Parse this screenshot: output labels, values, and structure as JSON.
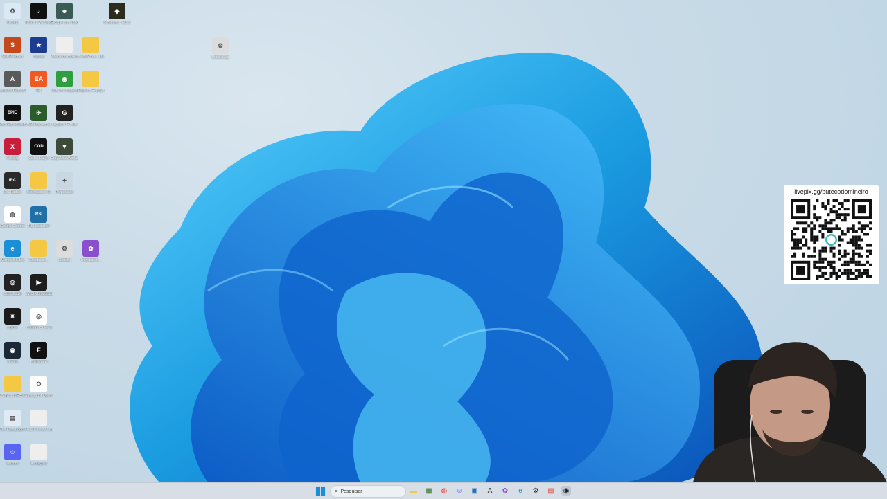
{
  "desktop": {
    "icons": [
      {
        "label": "Lixeira",
        "icon": "recycle-bin-icon",
        "color": "#dbe8f5",
        "glyph": "♻"
      },
      {
        "label": "TikTok LIVE Studio",
        "icon": "tiktok-icon",
        "color": "#111111",
        "glyph": "♪"
      },
      {
        "label": "Escape from Tarkov",
        "icon": "tarkov-icon",
        "color": "#3a5a55",
        "glyph": "☻"
      },
      {
        "label": "ScreenMi... Ajuda",
        "icon": "app-icon",
        "color": "#2b2b1e",
        "glyph": "◆"
      },
      {
        "label": "SCUM Admin",
        "icon": "scum-icon",
        "color": "#c4481a",
        "glyph": "S"
      },
      {
        "label": "Stanza",
        "icon": "app-icon",
        "color": "#1d3b8f",
        "glyph": "★"
      },
      {
        "label": "Vídeos do coisecti...",
        "icon": "document-icon",
        "color": "#eeeeee",
        "glyph": ""
      },
      {
        "label": "mediaProfil... (1)",
        "icon": "folder-icon",
        "color": "#f4c842",
        "glyph": ""
      },
      {
        "label": "Battlenet Games L...",
        "icon": "app-icon",
        "color": "#5a5a5a",
        "glyph": "A"
      },
      {
        "label": "EA",
        "icon": "ea-icon",
        "color": "#f05a22",
        "glyph": "EA"
      },
      {
        "label": "Teste de Integrac...",
        "icon": "app-icon",
        "color": "#2e9e3e",
        "glyph": "◉"
      },
      {
        "label": "Arquivos Replays",
        "icon": "folder-icon",
        "color": "#f4c842",
        "glyph": ""
      },
      {
        "label": "Epic Games Launcher",
        "icon": "epic-games-icon",
        "color": "#111111",
        "glyph": "EPIC"
      },
      {
        "label": "MSI Afterburner",
        "icon": "msi-afterburner-icon",
        "color": "#2a5d2a",
        "glyph": "✈"
      },
      {
        "label": "Logitech G HUB",
        "icon": "logitech-icon",
        "color": "#222222",
        "glyph": "G"
      },
      {
        "label": "FxSoug",
        "icon": "app-icon",
        "color": "#c81e3c",
        "glyph": "X"
      },
      {
        "label": "Call of Duty®",
        "icon": "call-of-duty-icon",
        "color": "#111111",
        "glyph": "COD"
      },
      {
        "label": "Gray Zone Warfare",
        "icon": "gray-zone-icon",
        "color": "#3d4a3a",
        "glyph": "▼"
      },
      {
        "label": "IRC Radars",
        "icon": "app-icon",
        "color": "#2a2a2a",
        "glyph": "IRC"
      },
      {
        "label": "Informações (1)",
        "icon": "folder-icon",
        "color": "#f4c842",
        "glyph": ""
      },
      {
        "label": "Preparacão",
        "icon": "app-icon",
        "color": "#c9d7e2",
        "glyph": "✦"
      },
      {
        "label": "Google Chrome",
        "icon": "chrome-icon",
        "color": "#ffffff",
        "glyph": "◍"
      },
      {
        "label": "RSI Launcher",
        "icon": "rsi-icon",
        "color": "#1f6fa8",
        "glyph": "RSI"
      },
      {
        "label": "Microsoft Edge",
        "icon": "edge-icon",
        "color": "#1a8fd6",
        "glyph": "e"
      },
      {
        "label": "Claudio.cs...",
        "icon": "folder-icon",
        "color": "#f4c842",
        "glyph": ""
      },
      {
        "label": "Cloudflu",
        "icon": "app-icon",
        "color": "#dcdcdc",
        "glyph": "⚙"
      },
      {
        "label": "Transparen...",
        "icon": "app-icon",
        "color": "#8a4fcf",
        "glyph": "✿"
      },
      {
        "label": "OBS Studio",
        "icon": "obs-icon",
        "color": "#222222",
        "glyph": "◎"
      },
      {
        "label": "NVIDIA Broadcast",
        "icon": "nvidia-icon",
        "color": "#1e1e1e",
        "glyph": "▶"
      },
      {
        "label": "Spider",
        "icon": "app-icon",
        "color": "#1a1a1a",
        "glyph": "✷"
      },
      {
        "label": "Camera Ciclovia",
        "icon": "app-icon",
        "color": "#ffffff",
        "glyph": "◎"
      },
      {
        "label": "Steam",
        "icon": "steam-icon",
        "color": "#1b2838",
        "glyph": "◉"
      },
      {
        "label": "Frameview",
        "icon": "app-icon",
        "color": "#111111",
        "glyph": "F"
      },
      {
        "label": "Downloads Ecoluxo",
        "icon": "folder-icon",
        "color": "#f4c842",
        "glyph": ""
      },
      {
        "label": "Navegador Opera GX",
        "icon": "opera-gx-icon",
        "color": "#ffffff",
        "glyph": "O"
      },
      {
        "label": "Free Flying Light Tu...",
        "icon": "app-icon",
        "color": "#dfeaf5",
        "glyph": "▤"
      },
      {
        "label": "FR_TR Verify Vko ti dai...",
        "icon": "document-icon",
        "color": "#eeeeee",
        "glyph": ""
      },
      {
        "label": "Discord",
        "icon": "discord-icon",
        "color": "#5865f2",
        "glyph": "☺"
      },
      {
        "label": "Anotações",
        "icon": "document-icon",
        "color": "#eeeeee",
        "glyph": ""
      },
      {
        "label": "Untitled.sjq",
        "icon": "app-icon",
        "color": "#dcdcdc",
        "glyph": "⚙"
      }
    ]
  },
  "overlay": {
    "qr_url": "livepix.gg/butecodomineiro",
    "qr_icon": "qr-code-icon"
  },
  "taskbar": {
    "search_placeholder": "Pesquisar",
    "apps": [
      {
        "name": "file-explorer-icon",
        "color": "#f4c842",
        "glyph": "▬"
      },
      {
        "name": "store-icon",
        "color": "#3b7a3b",
        "glyph": "▦"
      },
      {
        "name": "chrome-icon",
        "color": "#e8453c",
        "glyph": "◍"
      },
      {
        "name": "discord-icon",
        "color": "#5865f2",
        "glyph": "☺"
      },
      {
        "name": "terminal-icon",
        "color": "#1e6fbf",
        "glyph": "▣"
      },
      {
        "name": "app-icon",
        "color": "#333333",
        "glyph": "A"
      },
      {
        "name": "app-icon",
        "color": "#8a4fcf",
        "glyph": "✿"
      },
      {
        "name": "edge-icon",
        "color": "#1a8fd6",
        "glyph": "e"
      },
      {
        "name": "settings-icon",
        "color": "#222222",
        "glyph": "⚙"
      },
      {
        "name": "calendar-icon",
        "color": "#d9534f",
        "glyph": "▤"
      },
      {
        "name": "recording-icon",
        "color": "#1b2838",
        "glyph": "◉"
      }
    ]
  },
  "accent_color": "#1a9be0"
}
